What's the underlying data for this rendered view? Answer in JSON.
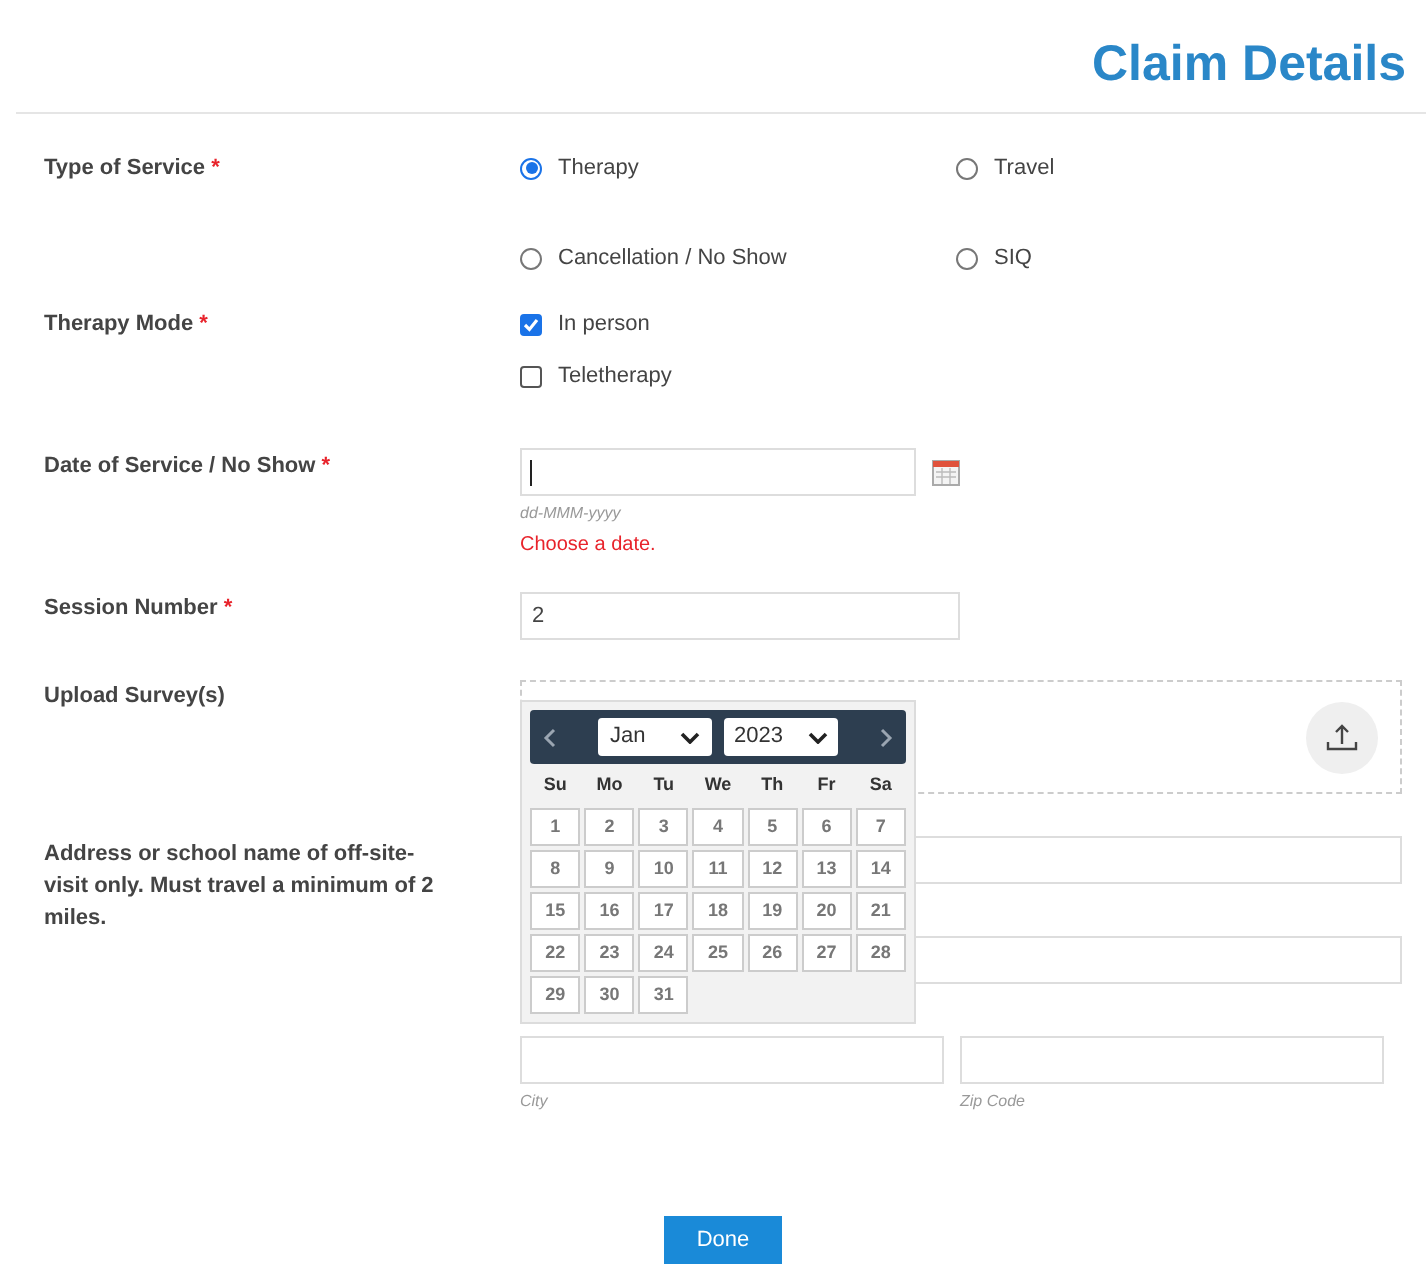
{
  "title": "Claim Details",
  "required_mark": "*",
  "sections": [
    {
      "kind": "radio",
      "label": "Type of Service",
      "required": true,
      "options": [
        {
          "label": "Therapy",
          "selected": true
        },
        {
          "label": "Travel",
          "selected": false
        },
        {
          "label": "Cancellation / No Show",
          "selected": false
        },
        {
          "label": "SIQ",
          "selected": false
        }
      ]
    },
    {
      "kind": "checkbox",
      "label": "Therapy Mode",
      "required": true,
      "options": [
        {
          "label": "In person",
          "checked": true
        },
        {
          "label": "Teletherapy",
          "checked": false
        }
      ]
    },
    {
      "kind": "date",
      "label": "Date of Service / No Show",
      "required": true,
      "hint": "dd-MMM-yyyy",
      "error": "Choose a date."
    },
    {
      "kind": "text",
      "label": "Session Number",
      "required": true,
      "value": "2"
    },
    {
      "kind": "upload",
      "label": "Upload Survey(s)",
      "required": false
    },
    {
      "kind": "address",
      "label": "Address or school name of off-site-visit only. Must travel a minimum of 2 miles.",
      "required": false,
      "city_caption": "City",
      "zip_caption": "Zip Code"
    }
  ],
  "datepicker": {
    "month": "Jan",
    "year": "2023",
    "weekdays": [
      "Su",
      "Mo",
      "Tu",
      "We",
      "Th",
      "Fr",
      "Sa"
    ],
    "days": [
      "1",
      "2",
      "3",
      "4",
      "5",
      "6",
      "7",
      "8",
      "9",
      "10",
      "11",
      "12",
      "13",
      "14",
      "15",
      "16",
      "17",
      "18",
      "19",
      "20",
      "21",
      "22",
      "23",
      "24",
      "25",
      "26",
      "27",
      "28",
      "29",
      "30",
      "31"
    ]
  },
  "done_button": "Done"
}
